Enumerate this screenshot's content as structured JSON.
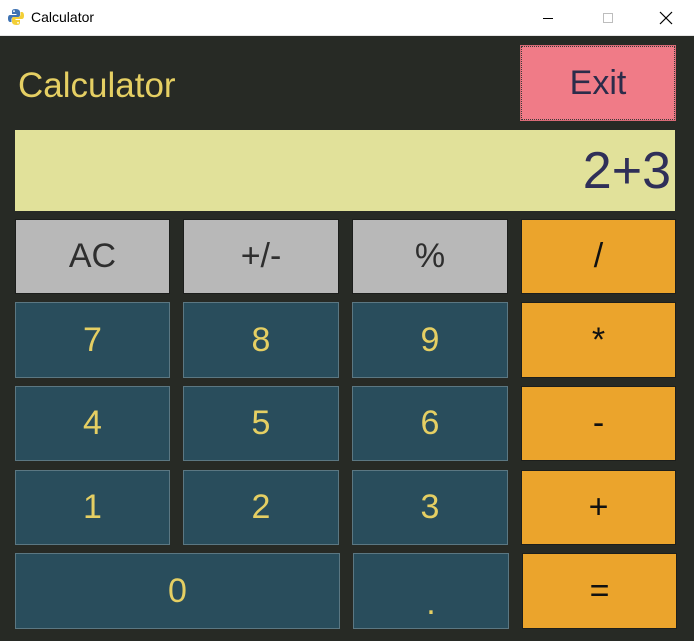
{
  "window": {
    "title": "Calculator"
  },
  "app": {
    "title": "Calculator",
    "exit_label": "Exit",
    "display_value": "2+3"
  },
  "keys": {
    "ac": "AC",
    "sign": "+/-",
    "percent": "%",
    "divide": "/",
    "seven": "7",
    "eight": "8",
    "nine": "9",
    "multiply": "*",
    "four": "4",
    "five": "5",
    "six": "6",
    "minus": "-",
    "one": "1",
    "two": "2",
    "three": "3",
    "plus": "+",
    "zero": "0",
    "decimal": ".",
    "equals": "="
  },
  "colors": {
    "background": "#272a25",
    "display_bg": "#e1e19a",
    "number_key": "#294d5c",
    "function_key": "#b8b8b8",
    "operator_key": "#eba42c",
    "exit_button": "#f07b87",
    "accent_text": "#e5cf63"
  }
}
